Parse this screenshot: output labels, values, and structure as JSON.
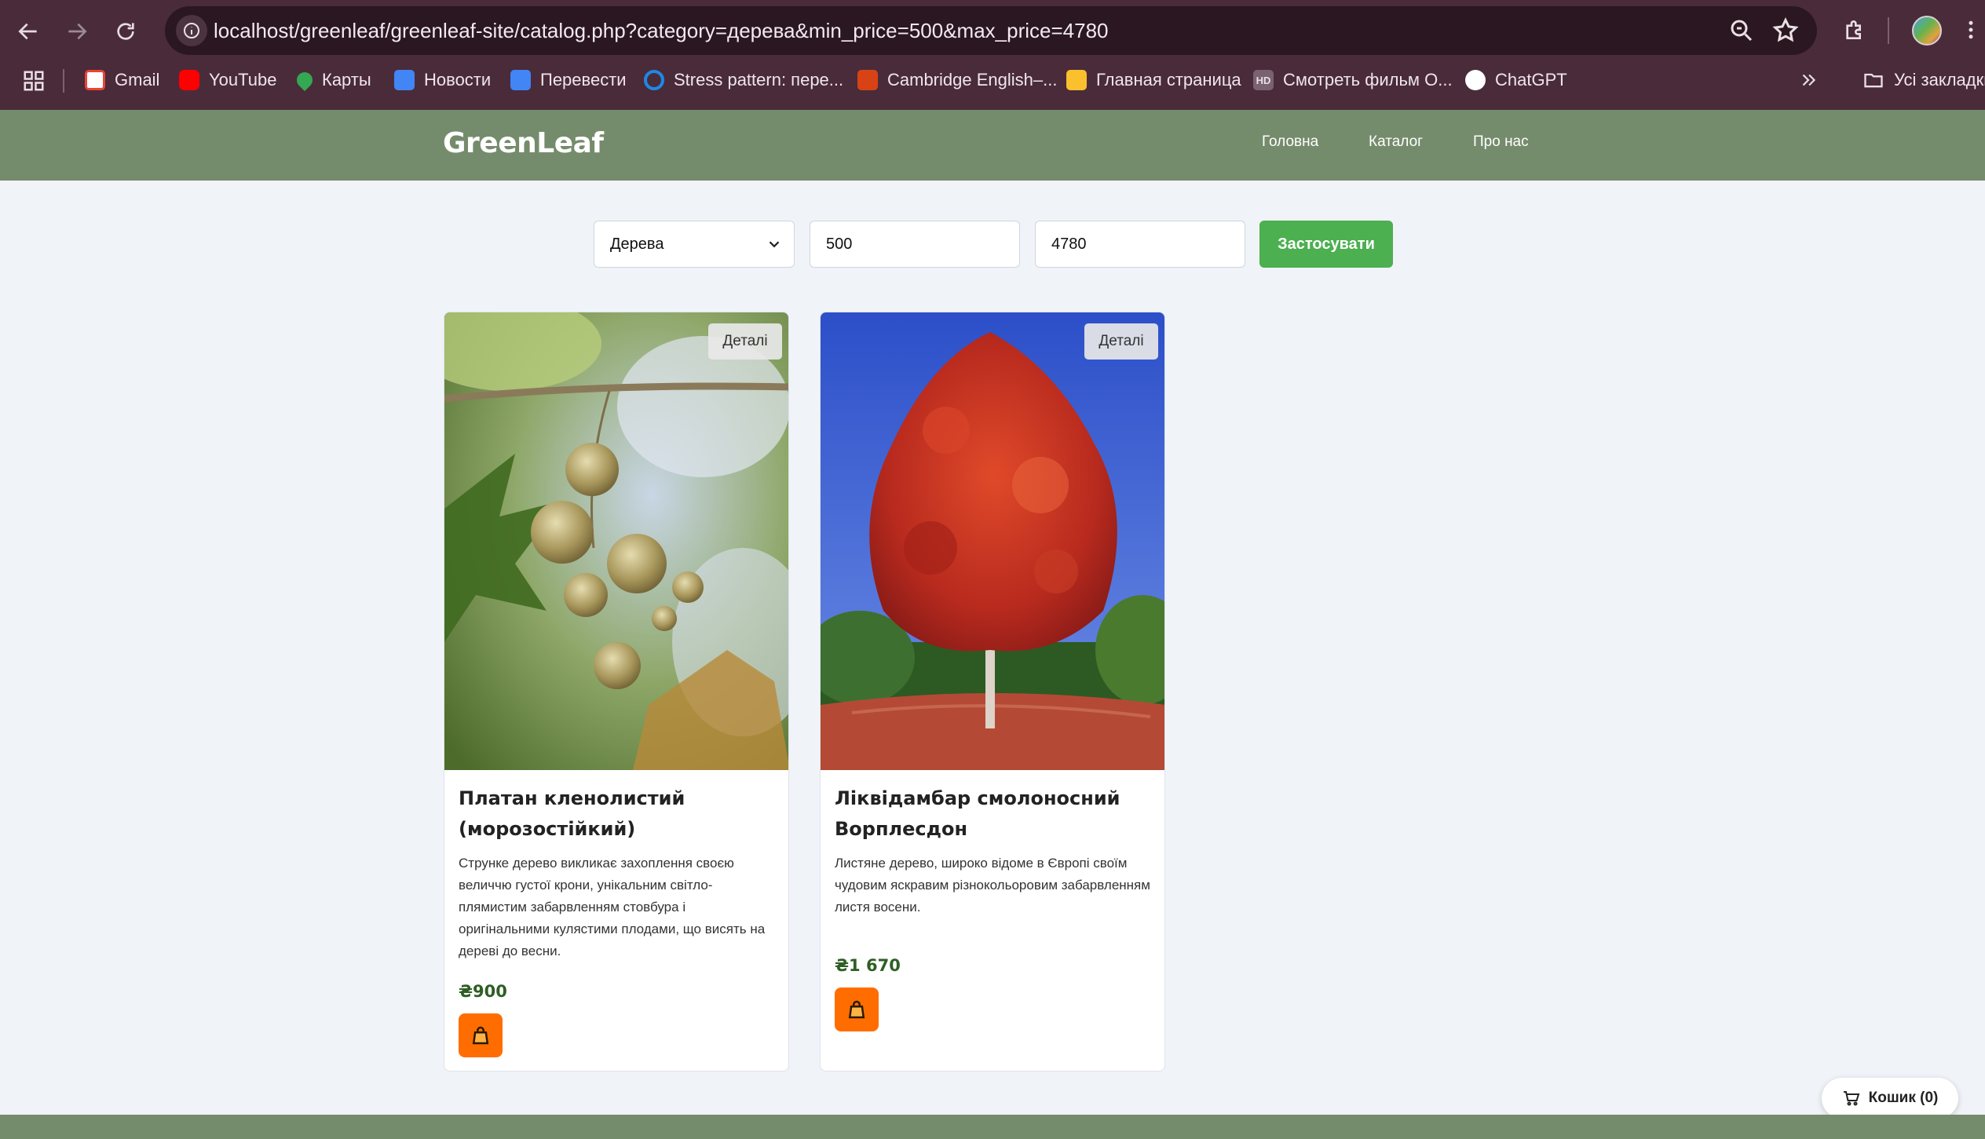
{
  "browser": {
    "url": "localhost/greenleaf/greenleaf-site/catalog.php?category=дерева&min_price=500&max_price=4780",
    "bookmarks": [
      {
        "label": "Gmail",
        "icon": "gmail-icon",
        "color": "#ea4335"
      },
      {
        "label": "YouTube",
        "icon": "youtube-icon",
        "color": "#ff0000"
      },
      {
        "label": "Карты",
        "icon": "maps-icon",
        "color": "#34a853"
      },
      {
        "label": "Новости",
        "icon": "news-icon",
        "color": "#4285f4"
      },
      {
        "label": "Перевести",
        "icon": "translate-icon",
        "color": "#4285f4"
      },
      {
        "label": "Stress pattern: пере...",
        "icon": "stress-icon",
        "color": "#1e88e5"
      },
      {
        "label": "Cambridge English–...",
        "icon": "cambridge-icon",
        "color": "#d84315"
      },
      {
        "label": "Главная страница",
        "icon": "classroom-icon",
        "color": "#fbc02d"
      },
      {
        "label": "Смотреть фильм О...",
        "icon": "hd-icon",
        "color": "#9e9e9e"
      },
      {
        "label": "ChatGPT",
        "icon": "chatgpt-icon",
        "color": "#ffffff"
      }
    ],
    "all_bookmarks_label": "Усі закладки"
  },
  "site": {
    "logo": "GreenLeaf",
    "nav": [
      "Головна",
      "Каталог",
      "Про нас"
    ],
    "accent_color": "#758c6c"
  },
  "filter": {
    "category": "Дерева",
    "min_price": "500",
    "max_price": "4780",
    "apply_label": "Застосувати"
  },
  "products": [
    {
      "details_label": "Деталі",
      "title": "Платан кленолистий (морозостійкий)",
      "description": "Стрункe дерево викликає захоплення своєю величчю густої крони, унікальним світло-плямистим забарвленням стовбура і оригінальними кулястими плодами, що висять на дереві до весни.",
      "price": "₴900",
      "image": "plane-tree-photo"
    },
    {
      "details_label": "Деталі",
      "title": "Ліквідамбар смолоносний Ворплесдон",
      "description": "Листяне дерево, широко відоме в Європі своїм чудовим яскравим різнокольоровим забарвленням листя восени.",
      "price": "₴1 670",
      "image": "sweetgum-tree-photo"
    }
  ],
  "cart": {
    "label": "Кошик (0)"
  }
}
